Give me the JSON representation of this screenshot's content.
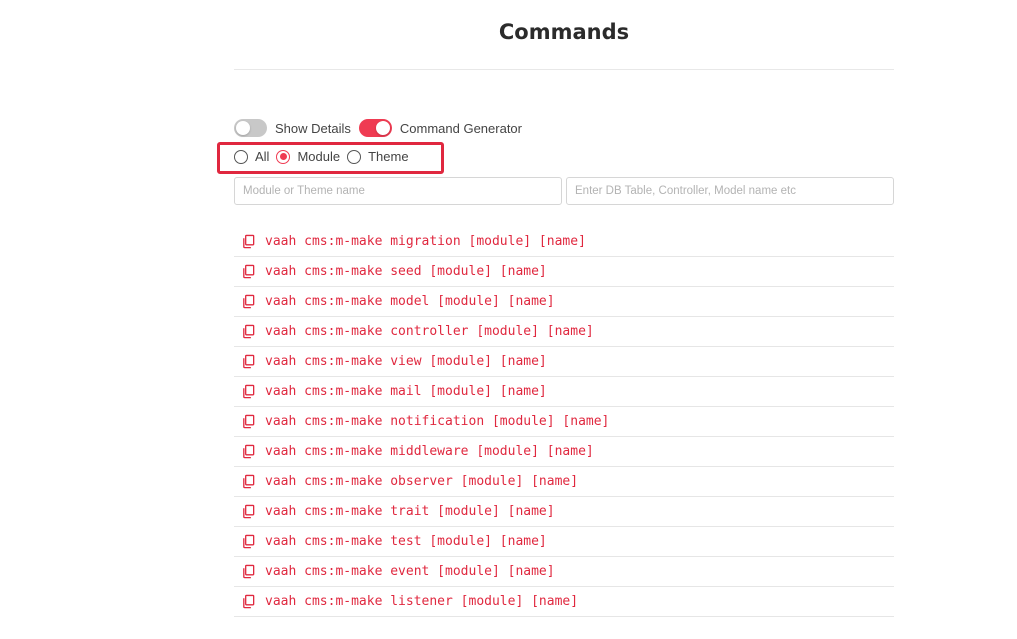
{
  "page": {
    "title": "Commands"
  },
  "toggles": {
    "show_details": {
      "label": "Show Details",
      "on": false
    },
    "command_generator": {
      "label": "Command Generator",
      "on": true
    }
  },
  "radios": {
    "selected": "Module",
    "options": [
      "All",
      "Module",
      "Theme"
    ]
  },
  "inputs": {
    "module_name": {
      "placeholder": "Module or Theme name",
      "value": ""
    },
    "entity_name": {
      "placeholder": "Enter DB Table, Controller, Model name etc",
      "value": ""
    }
  },
  "commands": [
    "vaah cms:m-make migration [module] [name]",
    "vaah cms:m-make seed [module] [name]",
    "vaah cms:m-make model [module] [name]",
    "vaah cms:m-make controller [module] [name]",
    "vaah cms:m-make view [module] [name]",
    "vaah cms:m-make mail [module] [name]",
    "vaah cms:m-make notification [module] [name]",
    "vaah cms:m-make middleware [module] [name]",
    "vaah cms:m-make observer [module] [name]",
    "vaah cms:m-make trait [module] [name]",
    "vaah cms:m-make test [module] [name]",
    "vaah cms:m-make event [module] [name]",
    "vaah cms:m-make listener [module] [name]"
  ],
  "icons": {
    "copy": "copy-icon"
  },
  "colors": {
    "accent": "#ef3b52",
    "highlight_border": "#e0283f",
    "command_text": "#e0283f"
  }
}
